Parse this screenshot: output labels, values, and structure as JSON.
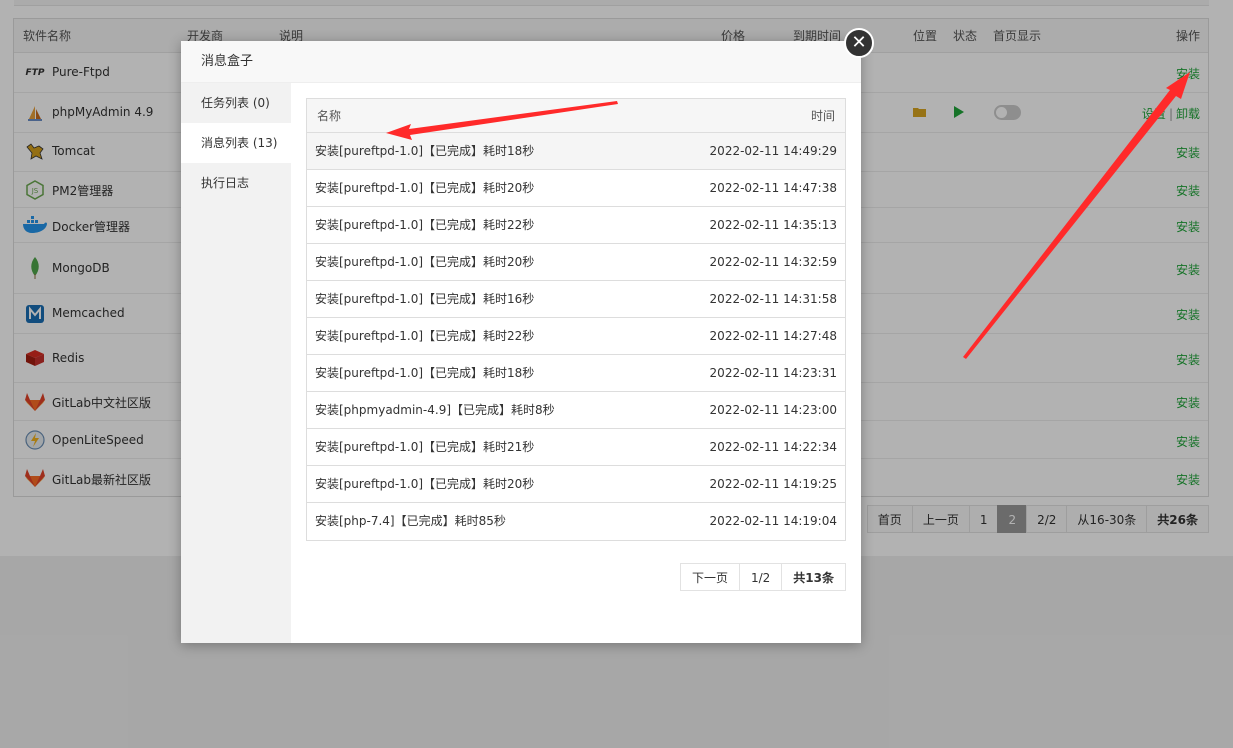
{
  "software_table": {
    "headers": {
      "name": "软件名称",
      "vendor": "开发商",
      "desc": "说明",
      "price": "价格",
      "expire": "到期时间",
      "location": "位置",
      "status": "状态",
      "homepage": "首页显示",
      "ops": "操作"
    },
    "rows": [
      {
        "name": "Pure-Ftpd",
        "op": "安装"
      },
      {
        "name": "phpMyAdmin 4.9",
        "op_settings": "设置",
        "op_sep": "|",
        "op_uninstall": "卸载"
      },
      {
        "name": "Tomcat",
        "op": "安装"
      },
      {
        "name": "PM2管理器",
        "op": "安装"
      },
      {
        "name": "Docker管理器",
        "op": "安装"
      },
      {
        "name": "MongoDB",
        "op": "安装"
      },
      {
        "name": "Memcached",
        "op": "安装"
      },
      {
        "name": "Redis",
        "op": "安装"
      },
      {
        "name": "GitLab中文社区版",
        "op": "安装"
      },
      {
        "name": "OpenLiteSpeed",
        "op": "安装"
      },
      {
        "name": "GitLab最新社区版",
        "op": "安装"
      }
    ],
    "icons": {
      "ftp_text": "FTP",
      "nodejs_text": "JS"
    },
    "pager": {
      "first": "首页",
      "prev": "上一页",
      "p1": "1",
      "p2": "2",
      "pages": "2/2",
      "range": "从16-30条",
      "total": "共26条"
    }
  },
  "modal": {
    "title": "消息盒子",
    "close_glyph": "✕",
    "tabs": [
      {
        "label": "任务列表 (0)"
      },
      {
        "label": "消息列表 (13)"
      },
      {
        "label": "执行日志"
      }
    ],
    "table": {
      "col_name": "名称",
      "col_time": "时间",
      "rows": [
        {
          "name": "安装[pureftpd-1.0]【已完成】耗时18秒",
          "time": "2022-02-11 14:49:29"
        },
        {
          "name": "安装[pureftpd-1.0]【已完成】耗时20秒",
          "time": "2022-02-11 14:47:38"
        },
        {
          "name": "安装[pureftpd-1.0]【已完成】耗时22秒",
          "time": "2022-02-11 14:35:13"
        },
        {
          "name": "安装[pureftpd-1.0]【已完成】耗时20秒",
          "time": "2022-02-11 14:32:59"
        },
        {
          "name": "安装[pureftpd-1.0]【已完成】耗时16秒",
          "time": "2022-02-11 14:31:58"
        },
        {
          "name": "安装[pureftpd-1.0]【已完成】耗时22秒",
          "time": "2022-02-11 14:27:48"
        },
        {
          "name": "安装[pureftpd-1.0]【已完成】耗时18秒",
          "time": "2022-02-11 14:23:31"
        },
        {
          "name": "安装[phpmyadmin-4.9]【已完成】耗时8秒",
          "time": "2022-02-11 14:23:00"
        },
        {
          "name": "安装[pureftpd-1.0]【已完成】耗时21秒",
          "time": "2022-02-11 14:22:34"
        },
        {
          "name": "安装[pureftpd-1.0]【已完成】耗时20秒",
          "time": "2022-02-11 14:19:25"
        },
        {
          "name": "安装[php-7.4]【已完成】耗时85秒",
          "time": "2022-02-11 14:19:04"
        }
      ]
    },
    "pager": {
      "next": "下一页",
      "pages": "1/2",
      "total": "共13条"
    }
  },
  "colors": {
    "install_green": "#20a53a",
    "annotation_red": "#ff2a2a"
  }
}
